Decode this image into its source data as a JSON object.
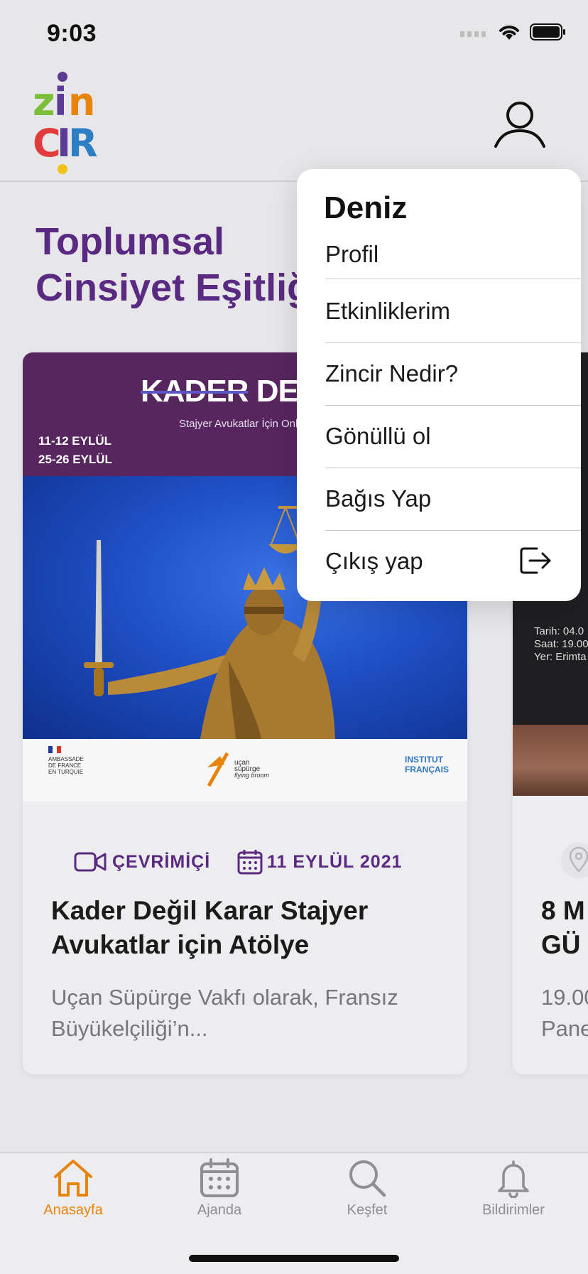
{
  "status_bar": {
    "time": "9:03",
    "icons": [
      "signal-icon",
      "wifi-icon",
      "battery-icon"
    ]
  },
  "header": {
    "logo": "Zincir",
    "profile_icon": "person-icon"
  },
  "section": {
    "title_line1": "Toplumsal",
    "title_line2": "Cinsiyet Eşitliğ"
  },
  "cards": [
    {
      "poster": {
        "title_strike": "KADER",
        "title_rest": "DEĞİL KA",
        "subtitle": "Stajyer Avukatlar İçin Online Atö",
        "dates": [
          "11-12 EYLÜL",
          "25-26 EYLÜL"
        ],
        "logos": {
          "ambassade": [
            "AMBASSADE",
            "DE FRANCE",
            "EN TURQUIE"
          ],
          "ucan": [
            "uçan",
            "süpürge",
            "flying broom"
          ],
          "institut": [
            "INSTITUT",
            "FRANÇAIS"
          ]
        }
      },
      "mode_label": "ÇEVRİMİÇİ",
      "date_label": "11 EYLÜL 2021",
      "title": "Kader Değil Karar Stajyer Avukatlar için Atölye",
      "description": "Uçan Süpürge Vakfı olarak, Fransız Büyükelçiliği’n..."
    },
    {
      "poster_info": [
        "Tarih: 04.0",
        "Saat: 19.00",
        "Yer: Erimta"
      ],
      "title_line1": "8 M",
      "title_line2": "GÜ",
      "desc_line1": "19.00",
      "desc_line2": "Pane"
    }
  ],
  "menu": {
    "user_name": "Deniz",
    "items": [
      {
        "label": "Profil"
      },
      {
        "label": "Etkinliklerim"
      },
      {
        "label": "Zincir Nedir?"
      },
      {
        "label": "Gönüllü ol"
      },
      {
        "label": "Bağıs Yap"
      },
      {
        "label": "Çıkış yap",
        "icon": "logout-icon"
      }
    ]
  },
  "tabbar": {
    "active_color": "#e8830c",
    "inactive_color": "#8e8e93",
    "tabs": [
      {
        "label": "Anasayfa",
        "icon": "home-icon",
        "active": true
      },
      {
        "label": "Ajanda",
        "icon": "calendar-icon",
        "active": false
      },
      {
        "label": "Keşfet",
        "icon": "search-icon",
        "active": false
      },
      {
        "label": "Bildirimler",
        "icon": "bell-icon",
        "active": false
      }
    ]
  },
  "colors": {
    "brand_purple": "#5a2a82",
    "accent_orange": "#e8830c"
  }
}
